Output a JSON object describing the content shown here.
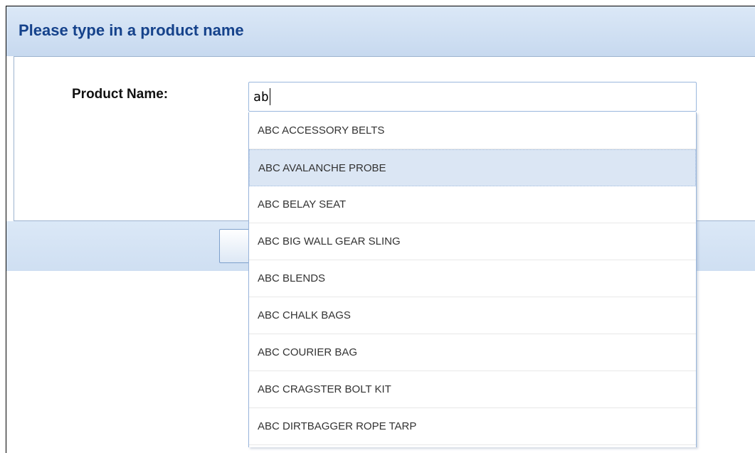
{
  "header": {
    "title": "Please type in a product name"
  },
  "form": {
    "label": "Product Name:",
    "input_value": "ab"
  },
  "dropdown": {
    "items": [
      {
        "label": "ABC ACCESSORY BELTS",
        "selected": false
      },
      {
        "label": "ABC AVALANCHE PROBE",
        "selected": true
      },
      {
        "label": "ABC BELAY SEAT",
        "selected": false
      },
      {
        "label": "ABC BIG WALL GEAR SLING",
        "selected": false
      },
      {
        "label": "ABC BLENDS",
        "selected": false
      },
      {
        "label": "ABC CHALK BAGS",
        "selected": false
      },
      {
        "label": "ABC COURIER BAG",
        "selected": false
      },
      {
        "label": "ABC CRAGSTER BOLT KIT",
        "selected": false
      },
      {
        "label": "ABC DIRTBAGGER ROPE TARP",
        "selected": false
      }
    ]
  },
  "colors": {
    "header_bg": "#c7d9ef",
    "title_text": "#15428b",
    "selection_bg": "#dbe6f4"
  }
}
